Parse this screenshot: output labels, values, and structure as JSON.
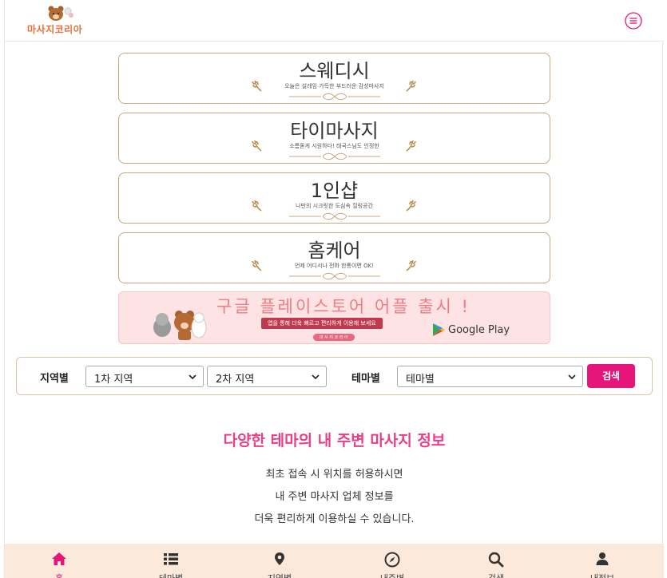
{
  "header": {
    "logo_text": "마사지코리아",
    "menu_icon": "menu-circle-icon"
  },
  "themes": [
    {
      "title": "스웨디시",
      "subtitle": "오늘은 설레임 가득한 부드러운 감성마사지"
    },
    {
      "title": "타이마사지",
      "subtitle": "소름돋게 시원하다! 태국스님도 인정한"
    },
    {
      "title": "1인샵",
      "subtitle": "나만의 시크릿한 도심속 힐링공간"
    },
    {
      "title": "홈케어",
      "subtitle": "언제 어디서나 전화 한통이면 OK!"
    }
  ],
  "banner": {
    "title": "구글 플레이스토어 어플 출시 !",
    "subtitle": "앱을 통해 더욱 빠르고 편리하게 이용해 보세요",
    "small": "마 사 지 코 리 아",
    "store_label": "Google Play"
  },
  "search": {
    "region_label": "지역별",
    "region1": "1차 지역",
    "region2": "2차 지역",
    "theme_label": "테마별",
    "theme_value": "테마별",
    "button": "검색"
  },
  "info": {
    "title": "다양한 테마의 내 주변 마사지 정보",
    "lines": [
      "최초 접속 시 위치를 허용하시면",
      "내 주변 마사지 업체 정보를",
      "더욱 편리하게 이용하실 수 있습니다."
    ]
  },
  "colors": {
    "accent": "#e5157a",
    "card_border": "#c9a77b",
    "nav_bg": "#fbeadc",
    "info_title": "#ee3d87"
  },
  "bottom_nav": [
    {
      "label": "홈",
      "icon": "home-icon",
      "active": true
    },
    {
      "label": "테마별",
      "icon": "list-icon"
    },
    {
      "label": "지역별",
      "icon": "map-marker-icon"
    },
    {
      "label": "내주변",
      "icon": "compass-icon"
    },
    {
      "label": "검색",
      "icon": "search-icon"
    },
    {
      "label": "내정보",
      "icon": "user-icon"
    }
  ]
}
